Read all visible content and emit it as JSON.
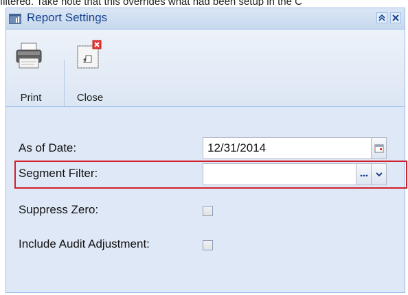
{
  "caption": "filtered. Take note that this overrides what had been setup in the C",
  "window": {
    "title": "Report Settings"
  },
  "toolbar": {
    "print_label": "Print",
    "close_label": "Close"
  },
  "fields": {
    "as_of_date": {
      "label": "As of Date:",
      "value": "12/31/2014"
    },
    "segment_filter": {
      "label": "Segment Filter:",
      "value": "",
      "ellipsis": "..."
    },
    "suppress_zero": {
      "label": "Suppress Zero:",
      "checked": false
    },
    "include_audit_adjustment": {
      "label": "Include Audit Adjustment:",
      "checked": false
    }
  },
  "icons": {
    "window": "report-window-icon",
    "collapse": "double-chevron-up-icon",
    "close": "close-x-icon",
    "print": "printer-icon",
    "close_tool": "close-document-icon",
    "calendar": "calendar-icon",
    "ellipsis": "ellipsis-icon",
    "dropdown": "chevron-down-icon"
  },
  "colors": {
    "accent": "#15428b",
    "highlight": "#d0202b",
    "panel_bg": "#dfe8f6"
  }
}
